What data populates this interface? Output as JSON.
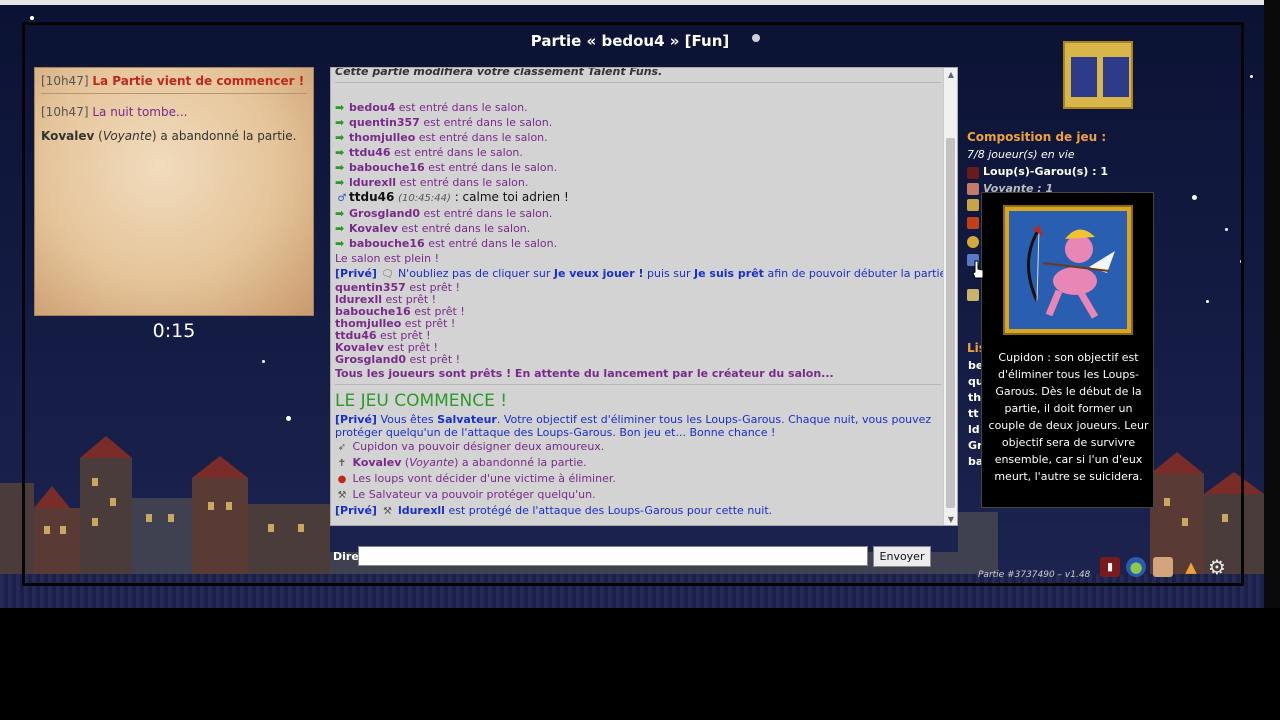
{
  "game": {
    "title": "Partie « bedou4 » [Fun]",
    "timer": "0:15",
    "version": "Partie #3737490 – v1.48"
  },
  "narrator": [
    {
      "time": "[10h47]",
      "text": "La Partie vient de commencer !",
      "style": "red"
    },
    {
      "time": "[10h47]",
      "text": "La nuit tombe...",
      "style": "purple"
    },
    {
      "player": "Kovalev",
      "role": "Voyante",
      "text": "a abandonné la partie."
    }
  ],
  "chat": {
    "header": "Cette partie modifiera votre classement Talent Funs.",
    "entered_suffix": "est entré dans le salon.",
    "ready_suffix": "est prêt !",
    "entries_before": [
      "bedou4",
      "quentin357",
      "thomjulleo",
      "ttdu46",
      "babouche16",
      "ldurexll"
    ],
    "chat_line": {
      "player": "ttdu46",
      "time": "(10:45:44)",
      "text": ": calme toi adrien !"
    },
    "entries_after": [
      "Grosgland0",
      "Kovalev",
      "babouche16"
    ],
    "salon_full": "Le salon est plein !",
    "private_tag": "[Privé]",
    "private_1": {
      "pre": "N'oubliez pas de cliquer sur",
      "b1": "Je veux jouer !",
      "mid": "puis sur",
      "b2": "Je suis prêt",
      "post": "afin de pouvoir débuter la partie !"
    },
    "ready": [
      "quentin357",
      "ldurexll",
      "babouche16",
      "thomjulleo",
      "ttdu46",
      "Kovalev",
      "Grosgland0"
    ],
    "all_ready": "Tous les joueurs sont prêts ! En attente du lancement par le créateur du salon...",
    "game_start": "LE JEU COMMENCE !",
    "role_msg": {
      "pre": "Vous êtes",
      "role": "Salvateur",
      "line1": ". Votre objectif est d'éliminer tous les Loups-Garous. Chaque nuit, vous pouvez",
      "line2": "protéger quelqu'un de l'attaque des Loups-Garous. Bon jeu et... Bonne chance !"
    },
    "cupid": "Cupidon va pouvoir désigner deux amoureux.",
    "quit": {
      "player": "Kovalev",
      "role": "Voyante",
      "text": "a abandonné la partie."
    },
    "wolves": "Les loups vont décider d'une victime à éliminer.",
    "salvateur": "Le Salvateur va pouvoir protéger quelqu'un.",
    "protect": {
      "player": "ldurexll",
      "text": "est protégé de l'attaque des Loups-Garous pour cette nuit."
    }
  },
  "input": {
    "say_label": "Dire",
    "value": "",
    "send_label": "Envoyer"
  },
  "composition": {
    "title": "Composition de jeu :",
    "alive": "7/8 joueur(s) en vie",
    "wolves": "Loup(s)-Garou(s) : 1",
    "voyante": "Voyante : 1"
  },
  "players_list": {
    "title_partial": "Lis",
    "partial_names": [
      "be",
      "qu",
      "th",
      "tt",
      "ld",
      "Gr",
      "ba"
    ]
  },
  "tooltip": {
    "text": "Cupidon : son objectif est d'éliminer tous les Loups-Garous. Dès le début de la partie, il doit former un couple de deux joueurs. Leur objectif sera de survivre ensemble, car si l'un d'eux meurt, l'autre se suicidera."
  },
  "colors": {
    "accent_orange": "#f0a23a",
    "private_blue": "#1a2ec8",
    "player_purple": "#7a2a8a",
    "arrow_green": "#2a9a2a",
    "alert_red": "#c0281c"
  },
  "toolbar_icons": [
    "stats-icon",
    "globe-icon",
    "map-icon",
    "alert-icon",
    "gear-icon"
  ]
}
